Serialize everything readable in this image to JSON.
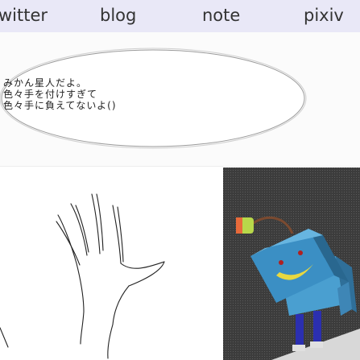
{
  "nav": {
    "items": [
      {
        "label": "witter"
      },
      {
        "label": "blog"
      },
      {
        "label": "note"
      },
      {
        "label": "pixiv"
      }
    ]
  },
  "speech_bubble": {
    "lines": [
      "みかん星人だよ。",
      "色々手を付けすぎて",
      "色々手に負えてないよ()"
    ]
  },
  "colors": {
    "nav_background": "#e9e8f7",
    "robot_blue": "#3b8fc4",
    "robot_smile": "#e8d840"
  },
  "images": {
    "left": "hand-sketch",
    "right": "robot-3d-render"
  }
}
